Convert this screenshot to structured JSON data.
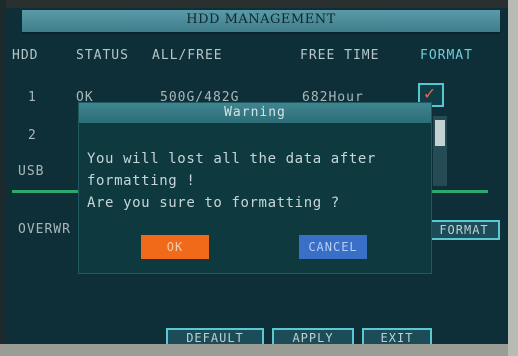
{
  "window": {
    "title": "HDD MANAGEMENT"
  },
  "table": {
    "headers": [
      "HDD",
      "STATUS",
      "ALL/FREE",
      "FREE TIME",
      "FORMAT"
    ],
    "rows": [
      {
        "hdd": "1",
        "status": "OK",
        "all_free": "500G/482G",
        "free_time": "682Hour",
        "format_checked": true
      },
      {
        "hdd": "2"
      },
      {
        "hdd": "USB"
      }
    ]
  },
  "overwrite_label": "OVERWR",
  "buttons": {
    "format": "FORMAT",
    "default": "DEFAULT",
    "apply": "APPLY",
    "exit": "EXIT"
  },
  "dialog": {
    "title": "Warning",
    "line1": "You will lost all the data after",
    "line2": "formatting !",
    "line3": "Are you sure to formatting ?",
    "ok": "OK",
    "cancel": "CANCEL"
  },
  "colors": {
    "ok": "#f06a1a",
    "cancel": "#3a6fc7",
    "accent": "#56c6cf",
    "check": "#e06a5e"
  }
}
